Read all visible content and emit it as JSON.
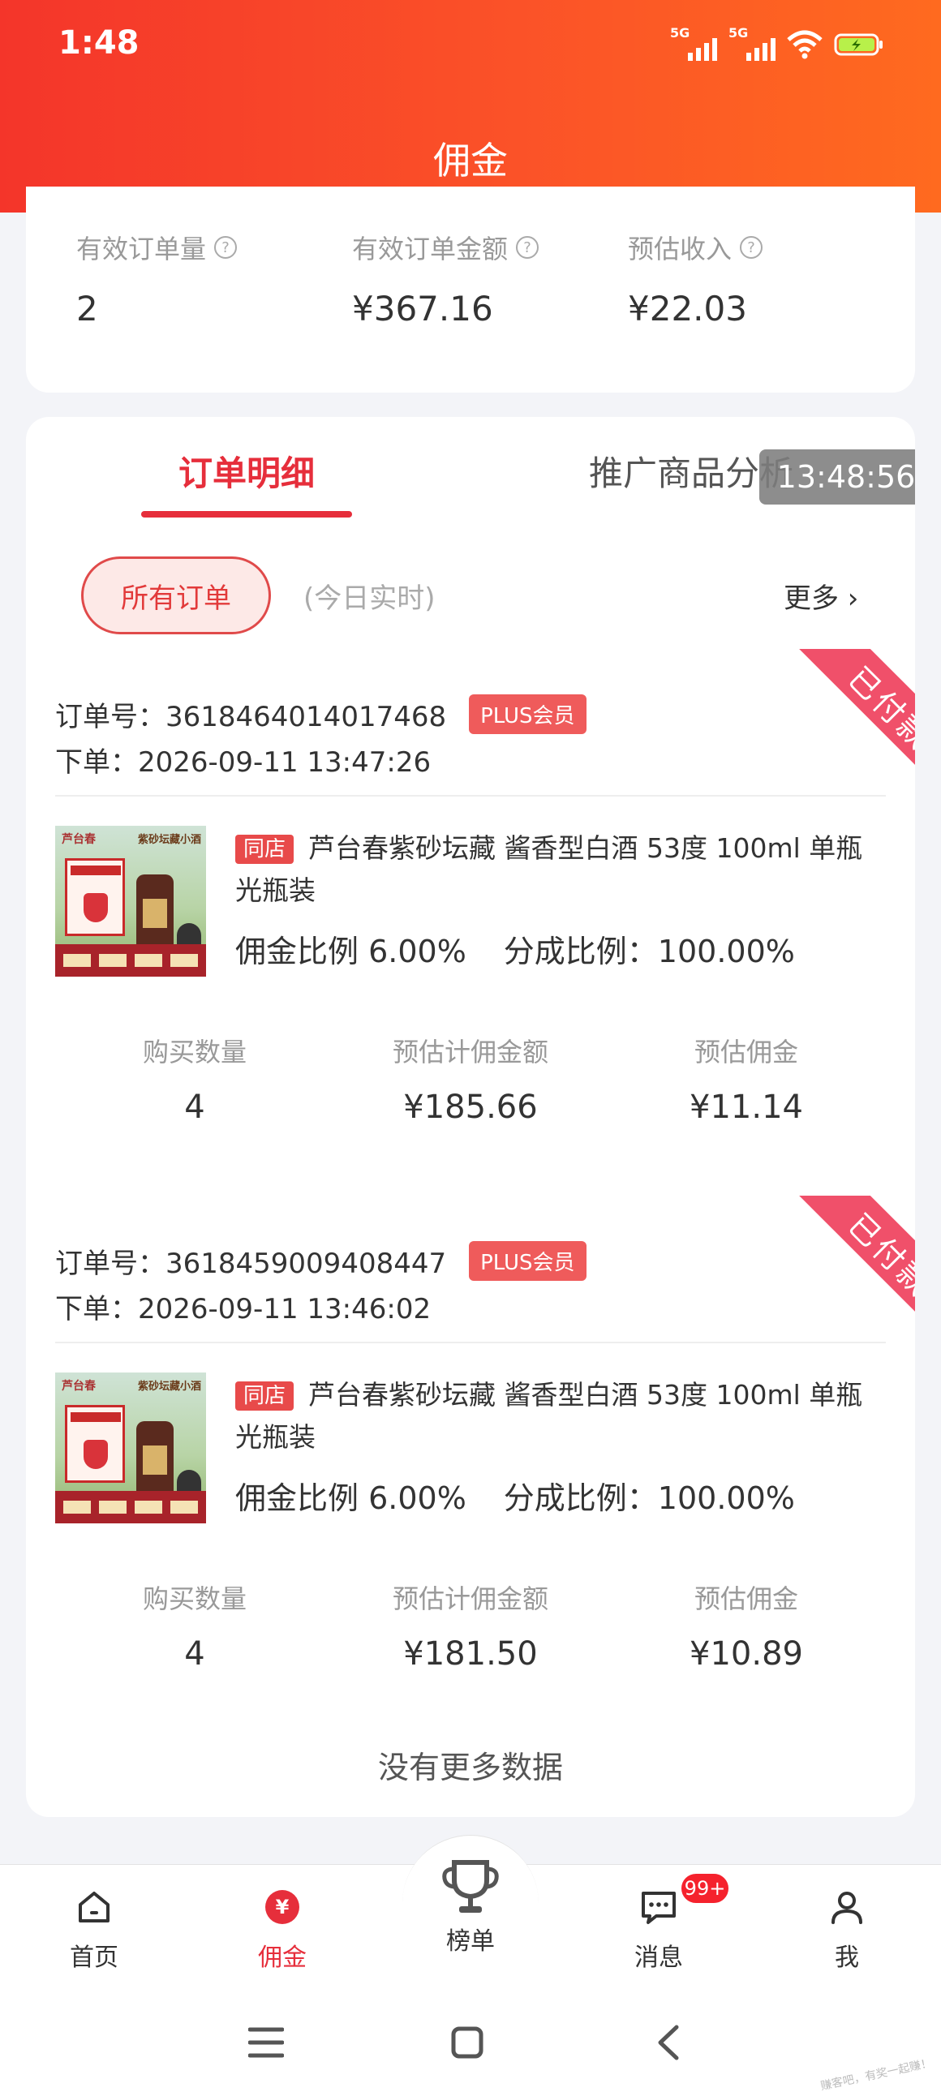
{
  "status_bar": {
    "time": "1:48",
    "network_1": "5G",
    "network_2": "5G"
  },
  "header": {
    "title": "佣金"
  },
  "summary": {
    "items": [
      {
        "label": "有效订单量",
        "value": "2"
      },
      {
        "label": "有效订单金额",
        "value": "¥367.16"
      },
      {
        "label": "预估收入",
        "value": "¥22.03"
      }
    ],
    "help_icon": "?"
  },
  "tabs": {
    "active": "订单明细",
    "inactive": "推广商品分析",
    "overlay_time": "13:48:56"
  },
  "filter": {
    "pill_label": "所有订单",
    "note": "(今日实时)",
    "more_label": "更多 ›"
  },
  "orders": [
    {
      "status": "已付款",
      "order_no": "订单号：3618464014017468",
      "member_badge": "PLUS会员",
      "order_time": "下单：2026-09-11 13:47:26",
      "store_tag": "同店",
      "product_title": "芦台春紫砂坛藏 酱香型白酒 53度 100ml 单瓶光瓶装",
      "commission_rate": "佣金比例 6.00%",
      "share_rate": "分成比例：100.00%",
      "metrics": [
        {
          "label": "购买数量",
          "value": "4"
        },
        {
          "label": "预估计佣金额",
          "value": "¥185.66"
        },
        {
          "label": "预估佣金",
          "value": "¥11.14"
        }
      ]
    },
    {
      "status": "已付款",
      "order_no": "订单号：3618459009408447",
      "member_badge": "PLUS会员",
      "order_time": "下单：2026-09-11 13:46:02",
      "store_tag": "同店",
      "product_title": "芦台春紫砂坛藏 酱香型白酒 53度 100ml 单瓶光瓶装",
      "commission_rate": "佣金比例 6.00%",
      "share_rate": "分成比例：100.00%",
      "metrics": [
        {
          "label": "购买数量",
          "value": "4"
        },
        {
          "label": "预估计佣金额",
          "value": "¥181.50"
        },
        {
          "label": "预估佣金",
          "value": "¥10.89"
        }
      ]
    }
  ],
  "product_image": {
    "brand": "芦台春",
    "headline": "紫砂坛藏小酒"
  },
  "no_more": "没有更多数据",
  "tabbar": {
    "items": [
      {
        "label": "首页",
        "icon": "home-icon"
      },
      {
        "label": "佣金",
        "icon": "yen-icon"
      },
      {
        "label": "榜单",
        "icon": "trophy-icon"
      },
      {
        "label": "消息",
        "icon": "message-icon"
      },
      {
        "label": "我",
        "icon": "user-icon"
      }
    ],
    "message_badge": "99+",
    "active_color": "#e62e3b"
  },
  "watermark": "赚客吧，有奖一起赚！",
  "colors": {
    "header_start": "#f4352a",
    "header_end": "#ff6a1f",
    "accent": "#e62e3b",
    "paid_ribbon": "#f0506a"
  }
}
